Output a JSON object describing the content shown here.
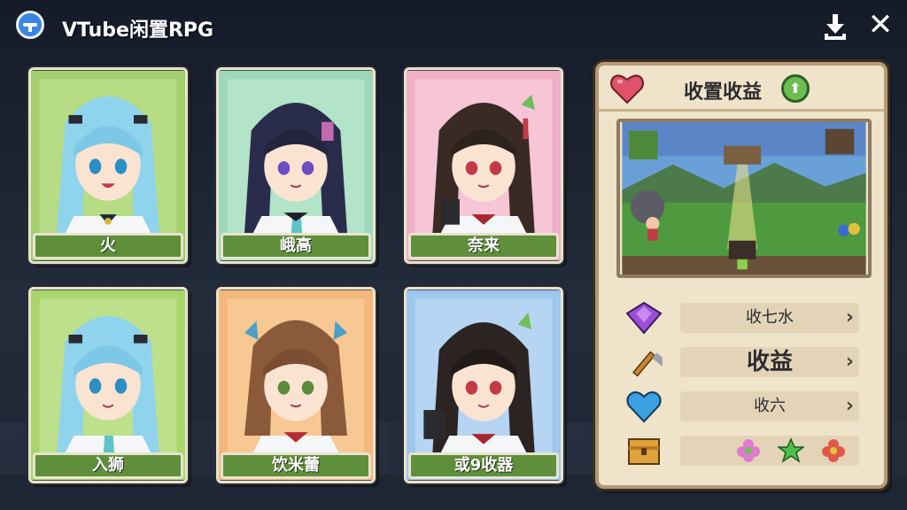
{
  "app": {
    "title": "VTube闲置RPG"
  },
  "characters": [
    {
      "name": "火",
      "bg": "#9fcc6a"
    },
    {
      "name": "峨高",
      "bg": "#9ed8b8"
    },
    {
      "name": "奈来",
      "bg": "#efb0c8"
    },
    {
      "name": "入狮",
      "bg": "#a9d66c"
    },
    {
      "name": "饮米蕾",
      "bg": "#f4b67a"
    },
    {
      "name": "或9收器",
      "bg": "#9fc6ec"
    }
  ],
  "panel": {
    "title": "收置收益",
    "badge": "⬆",
    "rows": [
      {
        "icon": "purple-gem-icon",
        "label": "收七水"
      },
      {
        "icon": "pickaxe-icon",
        "label": "收益"
      },
      {
        "icon": "blue-heart-icon",
        "label": "收六"
      },
      {
        "icon": "treasure-box-icon",
        "label": ""
      }
    ],
    "rewards": [
      "pink-flower-icon",
      "green-star-icon",
      "red-flower-icon"
    ]
  }
}
